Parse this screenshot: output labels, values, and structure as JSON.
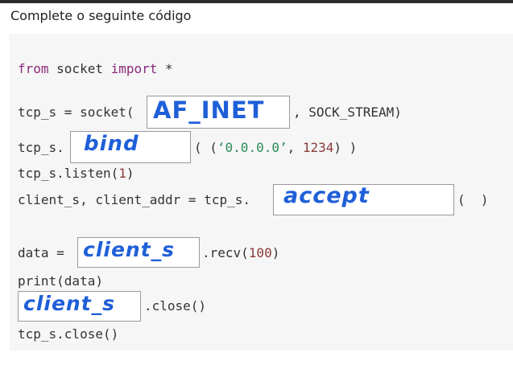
{
  "question": "Complete o seguinte código",
  "code": {
    "line1": {
      "kw_from": "from",
      "module": " socket ",
      "kw_import": "import",
      "rest": " *"
    },
    "line2": {
      "prefix": "tcp_s = socket(",
      "suffix": ", SOCK_STREAM)",
      "answer": "AF_INET"
    },
    "line3": {
      "prefix": "tcp_s.",
      "suffix_a": "( (",
      "str": "‘0.0.0.0’",
      "suffix_b": ", ",
      "num": "1234",
      "suffix_c": ") )",
      "answer": "bind"
    },
    "line4": {
      "prefix": "tcp_s.listen(",
      "num": "1",
      "suffix": ")"
    },
    "line5": {
      "prefix": "client_s, client_addr = tcp_s.",
      "suffix": "(  )",
      "answer": "accept"
    },
    "line6": {
      "prefix": "data = ",
      "suffix_a": ".recv(",
      "num": "100",
      "suffix_b": ")",
      "answer": "client_s"
    },
    "line7": {
      "text": "print(data)"
    },
    "line8": {
      "suffix": ".close()",
      "answer": "client_s"
    },
    "line9": {
      "text": "tcp_s.close()"
    }
  },
  "colors": {
    "keyword": "#8a2a7a",
    "number": "#8a3a3a",
    "string": "#2a8a55",
    "handwriting": "#1f5fd8"
  }
}
